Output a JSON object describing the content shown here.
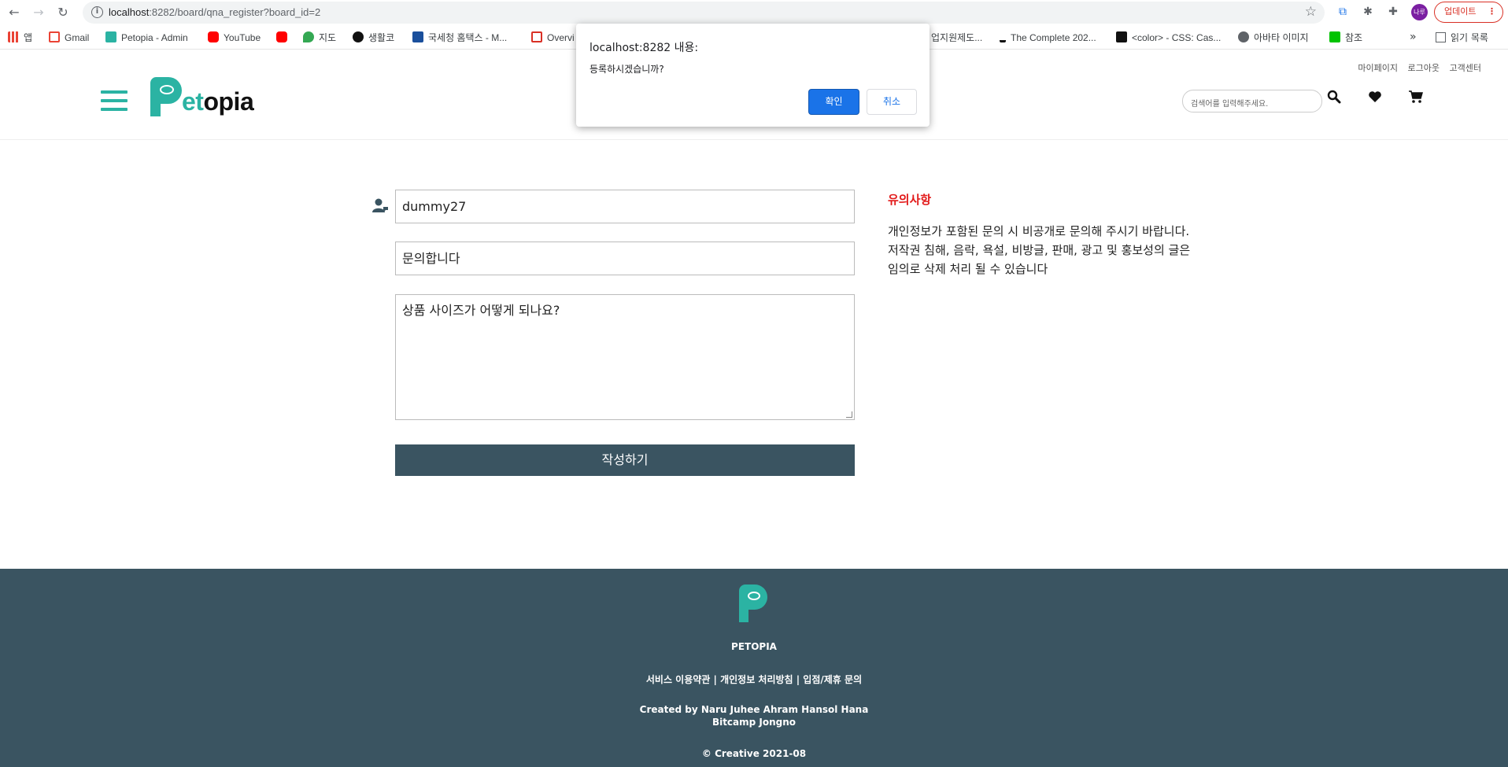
{
  "browser": {
    "url_host": "localhost",
    "url_rest": ":8282/board/qna_register?board_id=2",
    "profile_label": "나루",
    "update_label": "업데이트"
  },
  "bookmarks": [
    {
      "label": "앱",
      "icon": "apps-grid-icon",
      "color": "#ea4335"
    },
    {
      "label": "Gmail",
      "icon": "gmail-icon",
      "color": "#ea4335"
    },
    {
      "label": "Petopia - Admin",
      "icon": "petopia-icon",
      "color": "#2bb3a3"
    },
    {
      "label": "YouTube",
      "icon": "youtube-icon",
      "color": "#ff0000"
    },
    {
      "label": "",
      "icon": "youtube-icon",
      "color": "#ff0000"
    },
    {
      "label": "지도",
      "icon": "maps-pin-icon",
      "color": "#34a853"
    },
    {
      "label": "생활코",
      "icon": "circle-icon",
      "color": "#111111"
    },
    {
      "label": "국세청 홈택스 - M...",
      "icon": "hometax-icon",
      "color": "#1a4f9c"
    },
    {
      "label": "Overvi",
      "icon": "oracle-icon",
      "color": "#d93025"
    },
    {
      "label": "업지원제도...",
      "icon": "",
      "color": ""
    },
    {
      "label": "The Complete 202...",
      "icon": "udemy-icon",
      "color": "#111111"
    },
    {
      "label": "<color> - CSS: Cas...",
      "icon": "mdn-icon",
      "color": "#111111"
    },
    {
      "label": "아바타 이미지",
      "icon": "globe-icon",
      "color": "#5f6368"
    },
    {
      "label": "참조",
      "icon": "line-icon",
      "color": "#00c300"
    }
  ],
  "bookmarks_more": "»",
  "reading_list": "읽기 목록",
  "header": {
    "top_links": [
      "마이페이지",
      "로그아웃",
      "고객센터"
    ],
    "logo_p": "P",
    "logo_et": "et",
    "logo_rest": "opia",
    "search_placeholder": "검색어를 입력해주세요."
  },
  "form": {
    "writer": "dummy27",
    "title": "문의합니다",
    "content": "상품 사이즈가 어떻게 되나요?",
    "submit_label": "작성하기"
  },
  "notice": {
    "title": "유의사항",
    "body": "개인정보가 포함된 문의 시 비공개로 문의해 주시기 바랍니다. 저작권 침해, 음락, 욕설, 비방글, 판매, 광고 및 홍보성의 글은 임의로 삭제 처리 될 수 있습니다"
  },
  "footer": {
    "brand": "PETOPIA",
    "links": "서비스 이용약관 | 개인정보 처리방침 | 입점/제휴 문의",
    "credits_1": "Created by Naru Juhee Ahram Hansol Hana",
    "credits_2": "Bitcamp Jongno",
    "copyright": "© Creative 2021-08"
  },
  "dialog": {
    "title": "localhost:8282 내용:",
    "message": "등록하시겠습니까?",
    "ok_label": "확인",
    "cancel_label": "취소"
  },
  "colors": {
    "brand_teal": "#2bb3a3",
    "slate": "#3a5461",
    "notice_red": "#e21a1a",
    "dialog_blue": "#1a73e8"
  }
}
